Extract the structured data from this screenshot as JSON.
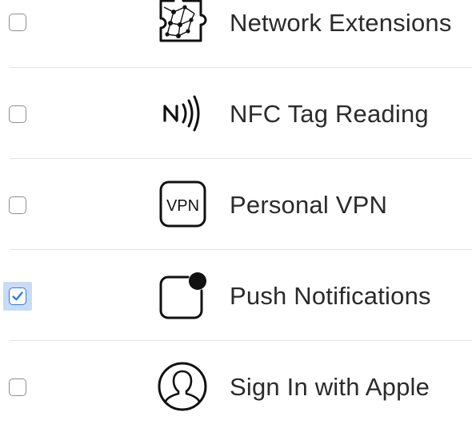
{
  "capabilities": [
    {
      "label": "Network Extensions",
      "icon": "network-extensions-icon",
      "checked": false
    },
    {
      "label": "NFC Tag Reading",
      "icon": "nfc-icon",
      "checked": false
    },
    {
      "label": "Personal VPN",
      "icon": "vpn-icon",
      "icon_text": "VPN",
      "checked": false
    },
    {
      "label": "Push Notifications",
      "icon": "push-notifications-icon",
      "checked": true
    },
    {
      "label": "Sign In with Apple",
      "icon": "sign-in-with-apple-icon",
      "checked": false
    }
  ],
  "colors": {
    "checkbox_accent": "#2f7bef",
    "focus_ring": "#c9dcf6",
    "divider": "#e3e3e3",
    "text": "#2b2b2b"
  }
}
